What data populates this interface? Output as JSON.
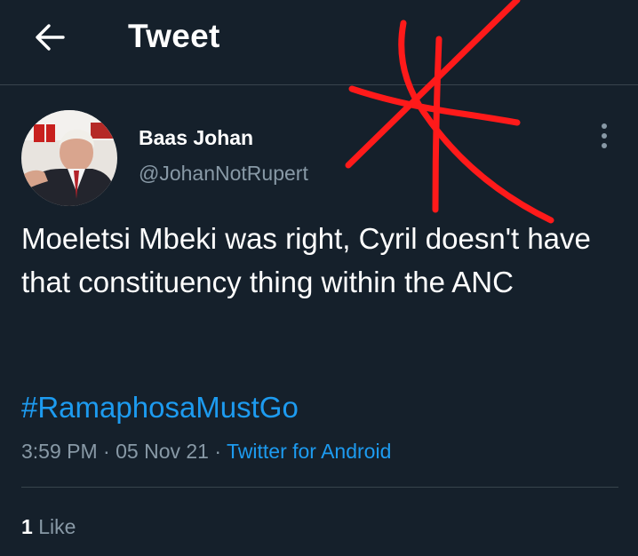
{
  "header": {
    "title": "Tweet",
    "back_icon": "arrow-left-icon"
  },
  "tweet": {
    "author": {
      "display_name": "Baas Johan",
      "handle": "@JohanNotRupert"
    },
    "text": "Moeletsi Mbeki was right, Cyril doesn't have that constituency thing within the ANC",
    "hashtag": "#RamaphosaMustGo",
    "time": "3:59 PM",
    "separator": " · ",
    "date": "05 Nov 21",
    "source": "Twitter for Android",
    "likes_count": "1",
    "likes_label": "Like"
  },
  "colors": {
    "background": "#15202b",
    "accent": "#1d9bf0",
    "secondary_text": "#8899a6",
    "divider": "#38444d",
    "annotation": "#ff1a1a"
  }
}
